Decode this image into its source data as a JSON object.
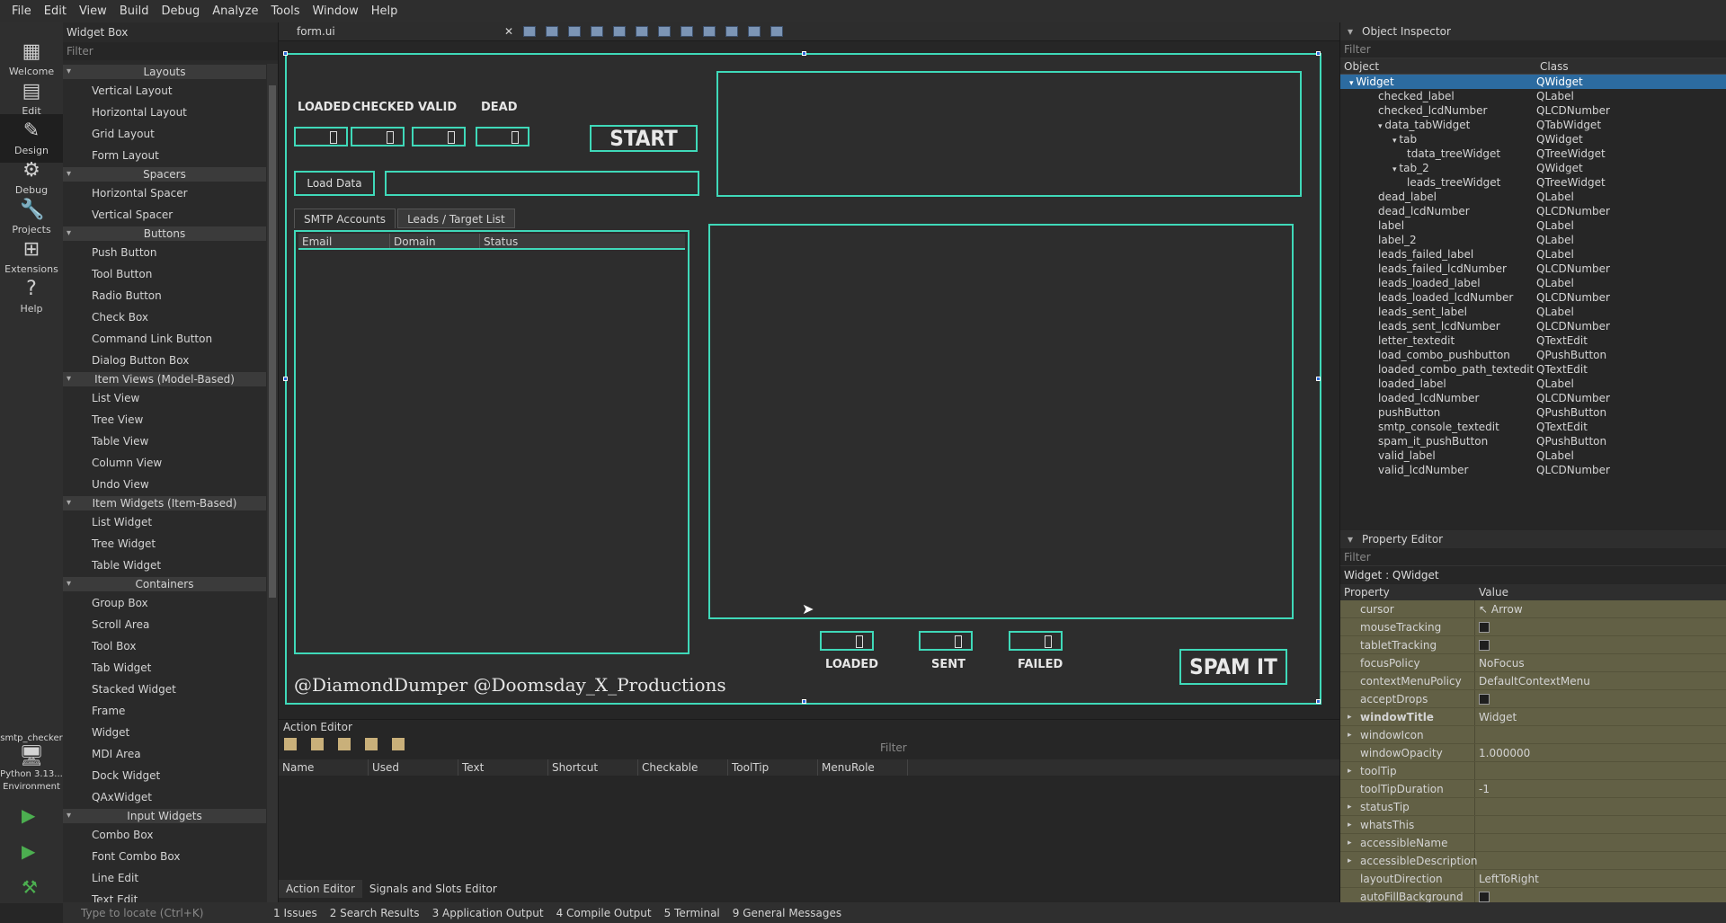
{
  "menu": [
    "File",
    "Edit",
    "View",
    "Build",
    "Debug",
    "Analyze",
    "Tools",
    "Window",
    "Help"
  ],
  "modes": [
    "Welcome",
    "Edit",
    "Design",
    "Debug",
    "Projects",
    "Extensions",
    "Help"
  ],
  "kit": {
    "project": "smtp_checker",
    "python": "Python 3.13...",
    "env": "Environment"
  },
  "widgetbox": {
    "title": "Widget Box",
    "filter": "Filter",
    "cats": [
      {
        "name": "Layouts",
        "items": [
          "Vertical Layout",
          "Horizontal Layout",
          "Grid Layout",
          "Form Layout"
        ]
      },
      {
        "name": "Spacers",
        "items": [
          "Horizontal Spacer",
          "Vertical Spacer"
        ]
      },
      {
        "name": "Buttons",
        "items": [
          "Push Button",
          "Tool Button",
          "Radio Button",
          "Check Box",
          "Command Link Button",
          "Dialog Button Box"
        ]
      },
      {
        "name": "Item Views (Model-Based)",
        "items": [
          "List View",
          "Tree View",
          "Table View",
          "Column View",
          "Undo View"
        ]
      },
      {
        "name": "Item Widgets (Item-Based)",
        "items": [
          "List Widget",
          "Tree Widget",
          "Table Widget"
        ]
      },
      {
        "name": "Containers",
        "items": [
          "Group Box",
          "Scroll Area",
          "Tool Box",
          "Tab Widget",
          "Stacked Widget",
          "Frame",
          "Widget",
          "MDI Area",
          "Dock Widget",
          "QAxWidget"
        ]
      },
      {
        "name": "Input Widgets",
        "items": [
          "Combo Box",
          "Font Combo Box",
          "Line Edit",
          "Text Edit"
        ]
      }
    ]
  },
  "editor": {
    "file": "form.ui"
  },
  "form": {
    "loaded": "LOADED",
    "checked": "CHECKED",
    "valid": "VALID",
    "dead": "DEAD",
    "start": "START",
    "load_data": "Load Data",
    "tabs": [
      "SMTP Accounts",
      "Leads / Target List"
    ],
    "cols": [
      "Email",
      "Domain",
      "Status"
    ],
    "b_loaded": "LOADED",
    "b_sent": "SENT",
    "b_failed": "FAILED",
    "spam": "SPAM IT",
    "credit": "@DiamondDumper  @Doomsday_X_Productions"
  },
  "actioneditor": {
    "title": "Action Editor",
    "filter": "Filter",
    "cols": [
      "Name",
      "Used",
      "Text",
      "Shortcut",
      "Checkable",
      "ToolTip",
      "MenuRole"
    ],
    "tabs": [
      "Action Editor",
      "Signals and Slots Editor"
    ]
  },
  "statusbar": {
    "locate": "Type to locate (Ctrl+K)",
    "panes": [
      "1  Issues",
      "2  Search Results",
      "3  Application Output",
      "4  Compile Output",
      "5  Terminal",
      "9  General Messages"
    ]
  },
  "inspector": {
    "title": "Object Inspector",
    "filter": "Filter",
    "col_obj": "Object",
    "col_class": "Class",
    "rows": [
      {
        "n": "Widget",
        "c": "QWidget",
        "d": 0,
        "sel": true
      },
      {
        "n": "checked_label",
        "c": "QLabel",
        "d": 1
      },
      {
        "n": "checked_lcdNumber",
        "c": "QLCDNumber",
        "d": 1
      },
      {
        "n": "data_tabWidget",
        "c": "QTabWidget",
        "d": 1
      },
      {
        "n": "tab",
        "c": "QWidget",
        "d": 2
      },
      {
        "n": "tdata_treeWidget",
        "c": "QTreeWidget",
        "d": 3
      },
      {
        "n": "tab_2",
        "c": "QWidget",
        "d": 2
      },
      {
        "n": "leads_treeWidget",
        "c": "QTreeWidget",
        "d": 3
      },
      {
        "n": "dead_label",
        "c": "QLabel",
        "d": 1
      },
      {
        "n": "dead_lcdNumber",
        "c": "QLCDNumber",
        "d": 1
      },
      {
        "n": "label",
        "c": "QLabel",
        "d": 1
      },
      {
        "n": "label_2",
        "c": "QLabel",
        "d": 1
      },
      {
        "n": "leads_failed_label",
        "c": "QLabel",
        "d": 1
      },
      {
        "n": "leads_failed_lcdNumber",
        "c": "QLCDNumber",
        "d": 1
      },
      {
        "n": "leads_loaded_label",
        "c": "QLabel",
        "d": 1
      },
      {
        "n": "leads_loaded_lcdNumber",
        "c": "QLCDNumber",
        "d": 1
      },
      {
        "n": "leads_sent_label",
        "c": "QLabel",
        "d": 1
      },
      {
        "n": "leads_sent_lcdNumber",
        "c": "QLCDNumber",
        "d": 1
      },
      {
        "n": "letter_textedit",
        "c": "QTextEdit",
        "d": 1
      },
      {
        "n": "load_combo_pushbutton",
        "c": "QPushButton",
        "d": 1
      },
      {
        "n": "loaded_combo_path_textedit",
        "c": "QTextEdit",
        "d": 1
      },
      {
        "n": "loaded_label",
        "c": "QLabel",
        "d": 1
      },
      {
        "n": "loaded_lcdNumber",
        "c": "QLCDNumber",
        "d": 1
      },
      {
        "n": "pushButton",
        "c": "QPushButton",
        "d": 1
      },
      {
        "n": "smtp_console_textedit",
        "c": "QTextEdit",
        "d": 1
      },
      {
        "n": "spam_it_pushButton",
        "c": "QPushButton",
        "d": 1
      },
      {
        "n": "valid_label",
        "c": "QLabel",
        "d": 1
      },
      {
        "n": "valid_lcdNumber",
        "c": "QLCDNumber",
        "d": 1
      }
    ]
  },
  "propeditor": {
    "title": "Property Editor",
    "filter": "Filter",
    "caption": "Widget : QWidget",
    "col_prop": "Property",
    "col_val": "Value",
    "rows": [
      {
        "p": "cursor",
        "v": "Arrow"
      },
      {
        "p": "mouseTracking",
        "v": "",
        "cb": true
      },
      {
        "p": "tabletTracking",
        "v": "",
        "cb": true
      },
      {
        "p": "focusPolicy",
        "v": "NoFocus"
      },
      {
        "p": "contextMenuPolicy",
        "v": "DefaultContextMenu"
      },
      {
        "p": "acceptDrops",
        "v": "",
        "cb": true
      },
      {
        "p": "windowTitle",
        "v": "Widget",
        "bold": true,
        "exp": true
      },
      {
        "p": "windowIcon",
        "v": "",
        "exp": true
      },
      {
        "p": "windowOpacity",
        "v": "1.000000"
      },
      {
        "p": "toolTip",
        "v": "",
        "exp": true
      },
      {
        "p": "toolTipDuration",
        "v": "-1"
      },
      {
        "p": "statusTip",
        "v": "",
        "exp": true
      },
      {
        "p": "whatsThis",
        "v": "",
        "exp": true
      },
      {
        "p": "accessibleName",
        "v": "",
        "exp": true
      },
      {
        "p": "accessibleDescription",
        "v": "",
        "exp": true
      },
      {
        "p": "layoutDirection",
        "v": "LeftToRight"
      },
      {
        "p": "autoFillBackground",
        "v": "",
        "cb": true
      }
    ]
  }
}
